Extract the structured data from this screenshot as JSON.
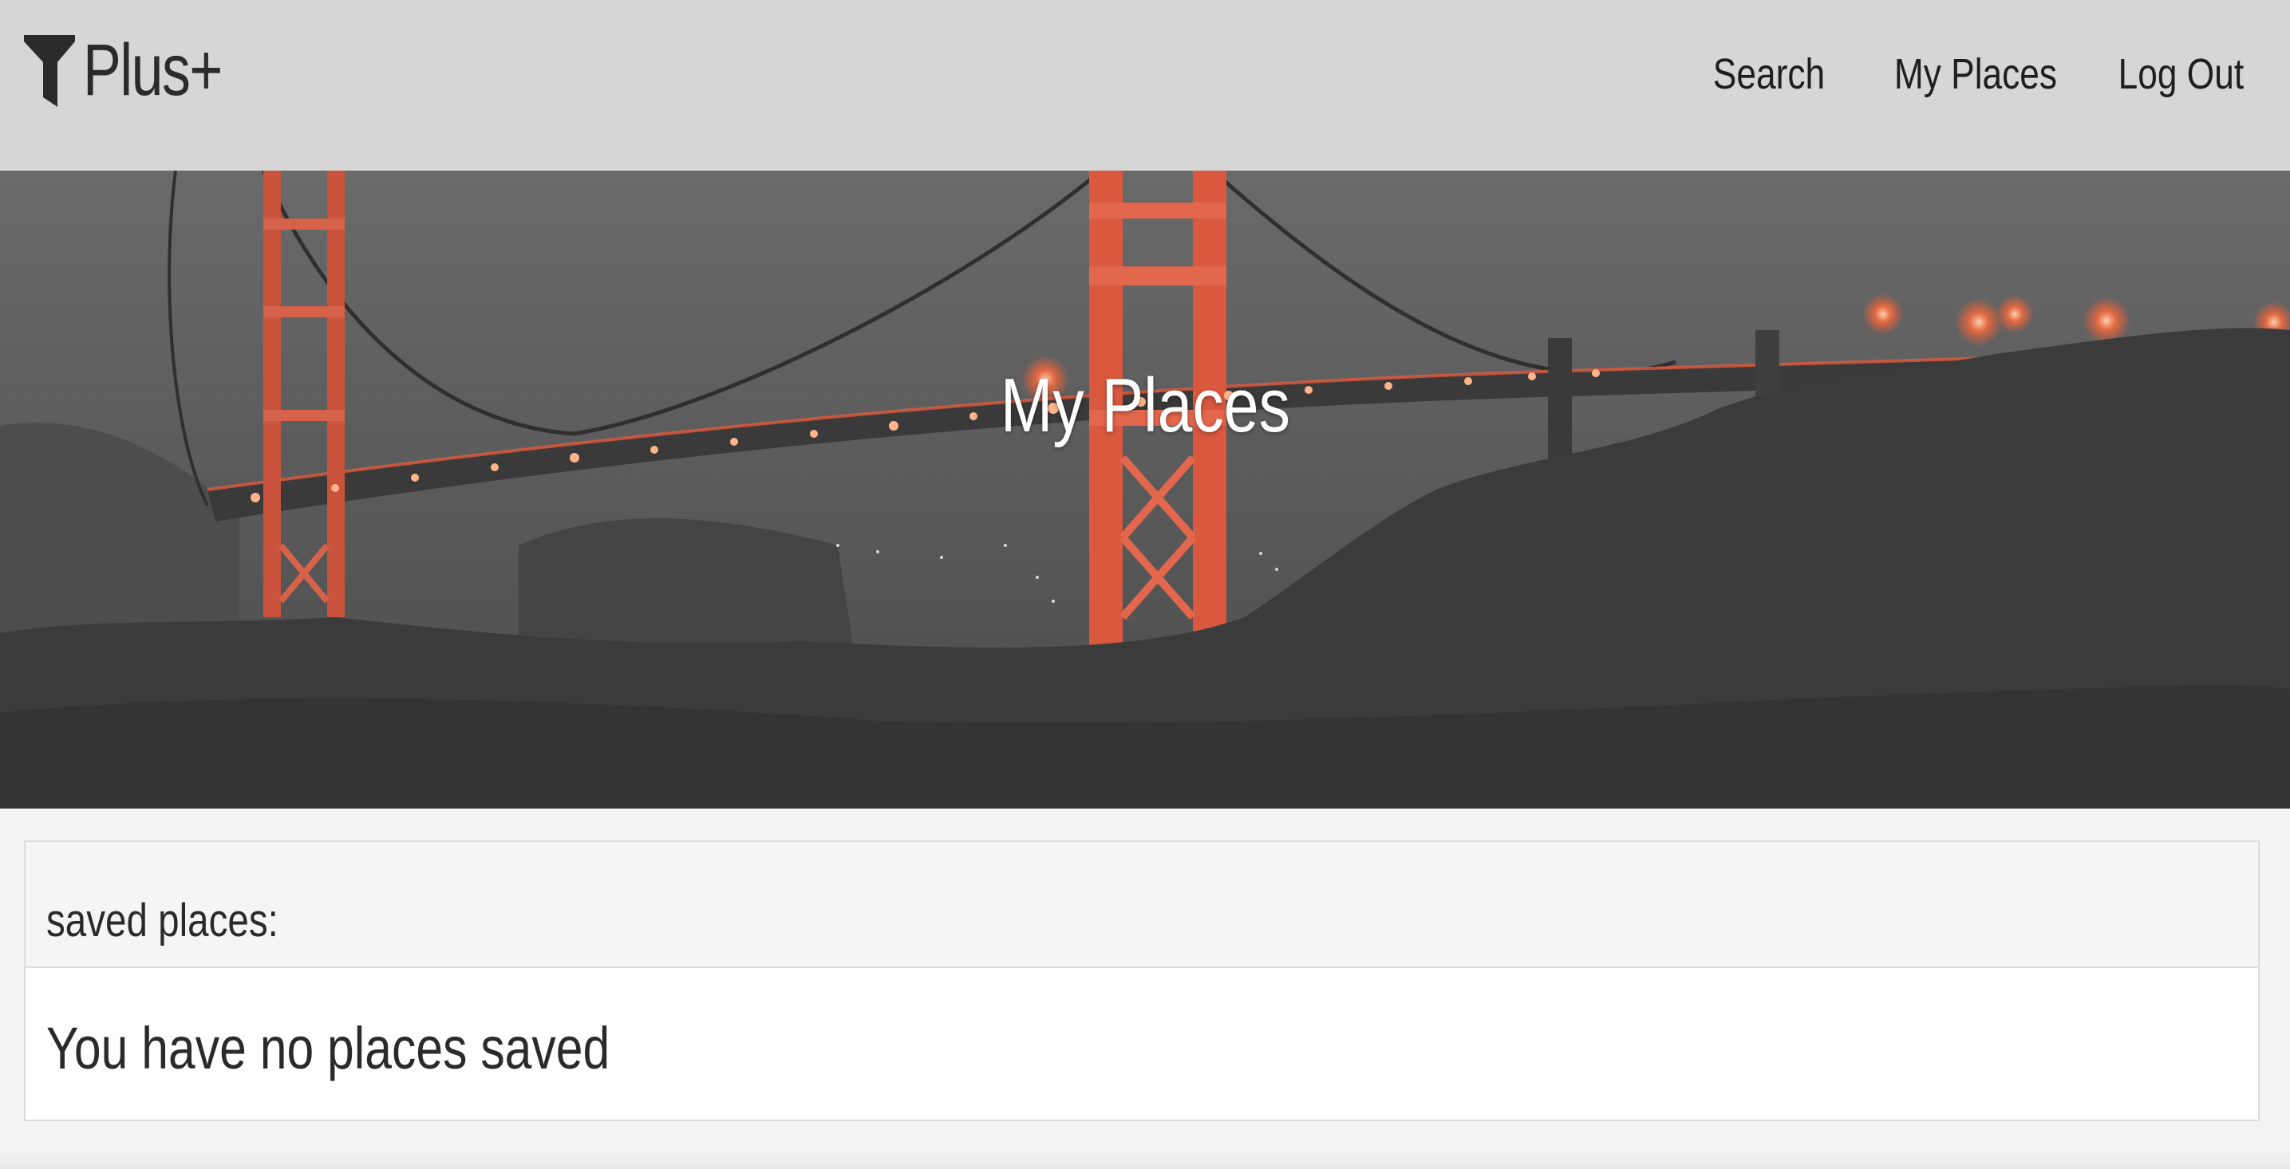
{
  "navbar": {
    "brand": {
      "icon": "filter-funnel-icon",
      "text": "Plus+"
    },
    "links": {
      "search": "Search",
      "my_places": "My Places",
      "log_out": "Log Out"
    }
  },
  "hero": {
    "title": "My Places",
    "image": "golden-gate-bridge-night-photo",
    "accent_color": "#e0523a"
  },
  "saved": {
    "header": "saved places:",
    "empty_message": "You have no places saved"
  }
}
